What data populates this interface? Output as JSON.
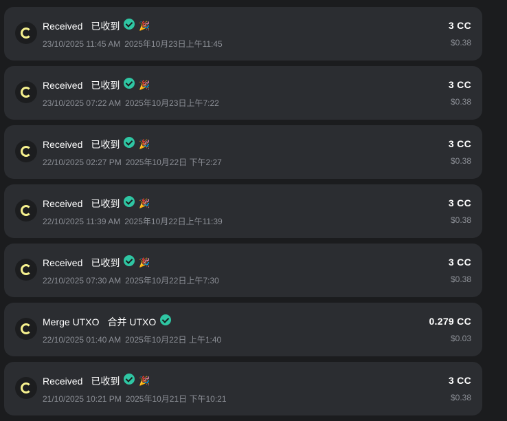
{
  "transactions": [
    {
      "title_en": "Received",
      "title_cn": "已收到",
      "verified": true,
      "party": true,
      "timestamp": "23/10/2025 11:45 AM",
      "timestamp_cn": "2025年10月23日上午11:45",
      "amount": "3 CC",
      "usd": "$0.38"
    },
    {
      "title_en": "Received",
      "title_cn": "已收到",
      "verified": true,
      "party": true,
      "timestamp": "23/10/2025 07:22 AM",
      "timestamp_cn": "2025年10月23日上午7:22",
      "amount": "3 CC",
      "usd": "$0.38"
    },
    {
      "title_en": "Received",
      "title_cn": "已收到",
      "verified": true,
      "party": true,
      "timestamp": "22/10/2025 02:27 PM",
      "timestamp_cn": "2025年10月22日 下午2:27",
      "amount": "3 CC",
      "usd": "$0.38"
    },
    {
      "title_en": "Received",
      "title_cn": "已收到",
      "verified": true,
      "party": true,
      "timestamp": "22/10/2025 11:39 AM",
      "timestamp_cn": "2025年10月22日上午11:39",
      "amount": "3 CC",
      "usd": "$0.38"
    },
    {
      "title_en": "Received",
      "title_cn": "已收到",
      "verified": true,
      "party": true,
      "timestamp": "22/10/2025 07:30 AM",
      "timestamp_cn": "2025年10月22日上午7:30",
      "amount": "3 CC",
      "usd": "$0.38"
    },
    {
      "title_en": "Merge UTXO",
      "title_cn": "合并 UTXO",
      "verified": true,
      "party": false,
      "timestamp": "22/10/2025 01:40 AM",
      "timestamp_cn": "2025年10月22日 上午1:40",
      "amount": "0.279 CC",
      "usd": "$0.03"
    },
    {
      "title_en": "Received",
      "title_cn": "已收到",
      "verified": true,
      "party": true,
      "timestamp": "21/10/2025 10:21 PM",
      "timestamp_cn": "2025年10月21日 下午10:21",
      "amount": "3 CC",
      "usd": "$0.38"
    }
  ],
  "icons": {
    "coin": "canton-coin-icon",
    "verified": "verified-check-icon",
    "party": "party-popper-icon"
  },
  "colors": {
    "background": "#1b1c1e",
    "card": "#2b2d31",
    "accent_check": "#2fc6a3",
    "coin_mark": "#f6f18e",
    "muted_text": "#8c8f96"
  },
  "party_glyph": "🎉"
}
